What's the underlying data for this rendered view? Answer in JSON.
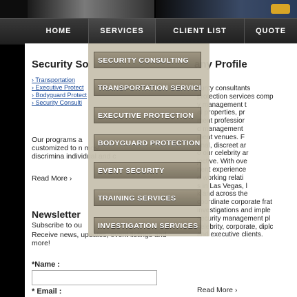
{
  "nav": {
    "items": [
      {
        "label": "HOME",
        "active": false
      },
      {
        "label": "SERVICES",
        "active": true
      },
      {
        "label": "CLIENT LIST",
        "active": false
      },
      {
        "label": "QUOTE",
        "active": false
      }
    ]
  },
  "dropdown": {
    "items": [
      "SECURITY CONSULTING",
      "TRANSPORTATION SERVICES",
      "EXECUTIVE PROTECTION",
      "BODYGUARD PROTECTION",
      "EVENT SECURITY",
      "TRAINING SERVICES",
      "INVESTIGATION SERVICES"
    ]
  },
  "left": {
    "title": "Security So",
    "links": [
      "› Transportation",
      "› Executive Protect",
      "› Bodyguard Protect",
      "› Security Consulti"
    ],
    "paragraph": "Our programs a customized to n most discrimina individual and c",
    "readmore": "Read More ›",
    "newsletter_title": "Newsletter",
    "newsletter_sub": "Subscribe to ou",
    "newsletter_text": "Receive news, updates, event listings and more!",
    "name_label": "*Name :",
    "email_label": "* Email :"
  },
  "right": {
    "title": "any Profile",
    "lines": [
      "curity consultants",
      "protection services comp",
      "y management t",
      "al properties, pr",
      "ment professior",
      "d management",
      "ment venues. F",
      "onal, discreet ar",
      "o our celebrity ar",
      "jective. With ove",
      "nent experience",
      "d working relati",
      "s in Las Vegas, l",
      "k and across the",
      "coordinate corporate frat",
      "investigations and imple",
      "security management pl",
      "celebrity, corporate, diplc",
      "and executive clients."
    ],
    "readmore": "Read More ›"
  }
}
